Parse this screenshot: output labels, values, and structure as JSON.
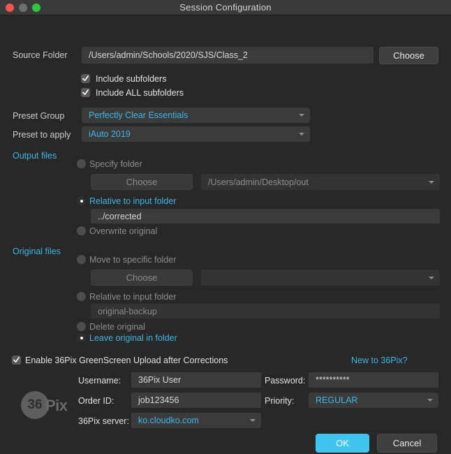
{
  "window": {
    "title": "Session Configuration",
    "traffic_lights": [
      "close",
      "minimize",
      "zoom"
    ]
  },
  "source": {
    "label": "Source Folder",
    "path": "/Users/admin/Schools/2020/SJS/Class_2",
    "choose_label": "Choose"
  },
  "checkboxes": [
    {
      "label": "Include subfolders",
      "checked": true
    },
    {
      "label": "Include ALL subfolders",
      "checked": true
    }
  ],
  "presets": {
    "group_label": "Preset Group",
    "group_value": "Perfectly Clear Essentials",
    "apply_label": "Preset to apply",
    "apply_value": "iAuto 2019"
  },
  "output_files": {
    "section_label": "Output files",
    "option_specify": "Specify folder",
    "specify_selected": false,
    "choose_label": "Choose",
    "specify_path": "/Users/admin/Desktop/out",
    "option_relative": "Relative to input folder",
    "relative_selected": true,
    "relative_path": "../corrected",
    "option_overwrite": "Overwrite original",
    "overwrite_selected": false
  },
  "original_files": {
    "section_label": "Original files",
    "option_move": "Move to specific folder",
    "move_selected": false,
    "choose_label": "Choose",
    "move_path": "",
    "option_relative": "Relative to input folder",
    "relative_selected": false,
    "relative_path": "original-backup",
    "option_delete": "Delete original",
    "delete_selected": false,
    "option_leave": "Leave original in folder",
    "leave_selected": true
  },
  "upload": {
    "enable_label": "Enable 36Pix GreenScreen Upload after Corrections",
    "enable_checked": true,
    "new_to_link": "New to 36Pix?",
    "logo_number": "36",
    "logo_word": "Pix",
    "username_label": "Username:",
    "username_value": "36Pix User",
    "password_label": "Password:",
    "password_value": "**********",
    "order_label": "Order ID:",
    "order_value": "job123456",
    "priority_label": "Priority:",
    "priority_value": "REGULAR",
    "server_label": "36Pix server:",
    "server_value": "ko.cloudko.com"
  },
  "footer": {
    "ok_label": "OK",
    "cancel_label": "Cancel"
  },
  "colors": {
    "accent": "#3fb6e8",
    "primary_button": "#40c4f0",
    "window_bg": "#282828",
    "titlebar_bg": "#3a3a3a"
  }
}
